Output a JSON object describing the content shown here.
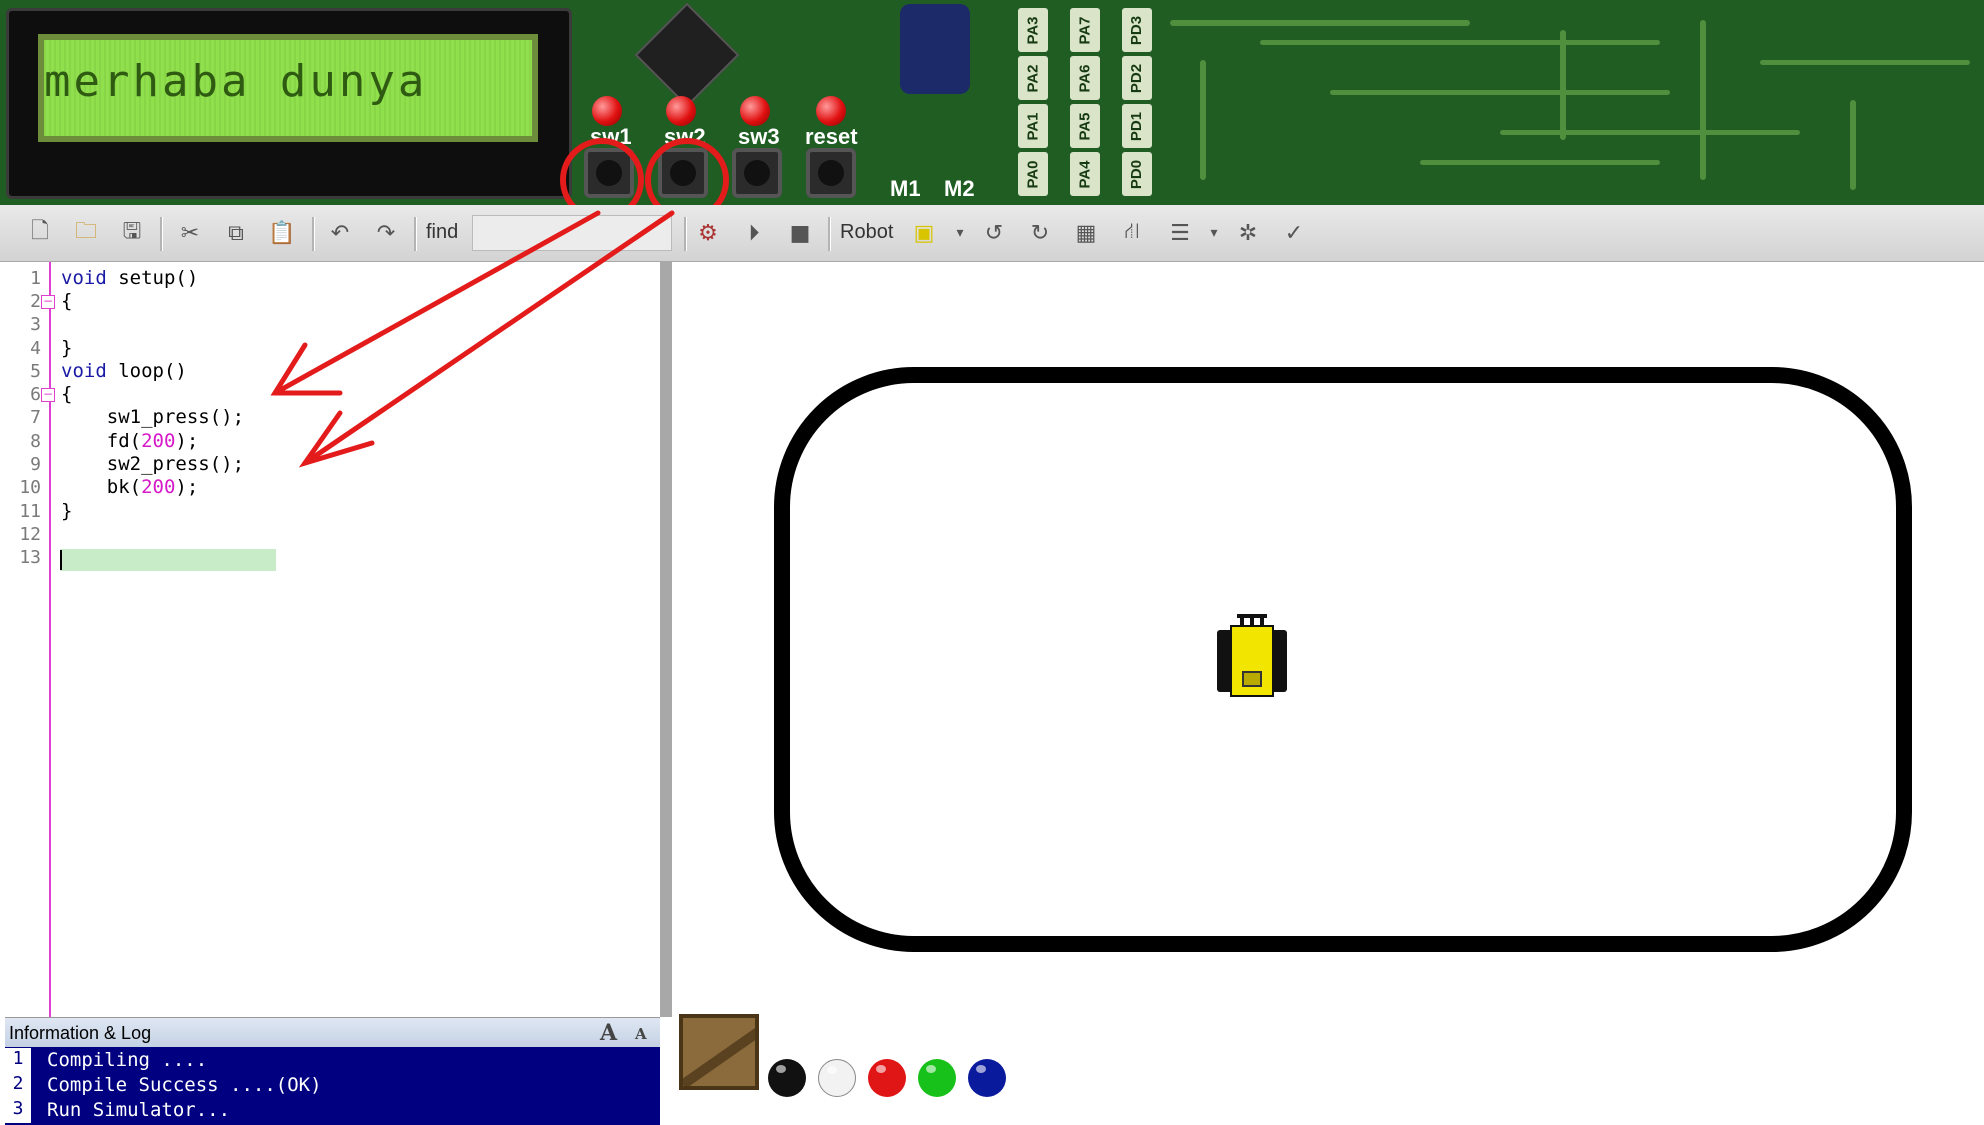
{
  "board": {
    "lcd_text": "merhaba dunya",
    "buttons": [
      {
        "label": "sw1"
      },
      {
        "label": "sw2"
      },
      {
        "label": "sw3"
      },
      {
        "label": "reset"
      }
    ],
    "motor_labels": [
      "M1",
      "M2"
    ],
    "port_pins": [
      "PA0",
      "PA1",
      "PA2",
      "PA3",
      "PA4",
      "PA5",
      "PA6",
      "PA7",
      "PD0",
      "PD1",
      "PD2",
      "PD3"
    ]
  },
  "toolbar": {
    "new_icon": "new-file-icon",
    "open_icon": "open-folder-icon",
    "save_icon": "save-icon",
    "cut_icon": "cut-icon",
    "copy_icon": "copy-icon",
    "paste_icon": "paste-icon",
    "undo_icon": "undo-icon",
    "redo_icon": "redo-icon",
    "find_label": "find",
    "find_value": "",
    "compile_icon": "gear-icon",
    "run_icon": "play-icon",
    "stop_icon": "stop-icon",
    "robot_label": "Robot"
  },
  "editor": {
    "line_numbers": [
      "1",
      "2",
      "3",
      "4",
      "5",
      "6",
      "7",
      "8",
      "9",
      "10",
      "11",
      "12",
      "13"
    ],
    "lines": [
      "void setup()",
      "{",
      "",
      "}",
      "void loop()",
      "{",
      "    sw1_press();",
      "    fd(200);",
      "    sw2_press();",
      "    bk(200);",
      "}",
      "",
      ""
    ]
  },
  "log": {
    "title": "Information & Log",
    "font_up": "A",
    "font_down": "A",
    "line_numbers": [
      "1",
      "2",
      "3"
    ],
    "lines": [
      "Compiling ....",
      "Compile Success ....(OK)",
      "Run Simulator..."
    ]
  },
  "simulator": {
    "ball_colors": [
      "#111111",
      "#f2f2f2",
      "#e01515",
      "#17c11a",
      "#0a1a9c"
    ]
  },
  "colors": {
    "annotation_red": "#e31b1b",
    "log_background": "#000080",
    "keyword_blue": "#1a1aa6",
    "number_magenta": "#d619c9"
  }
}
